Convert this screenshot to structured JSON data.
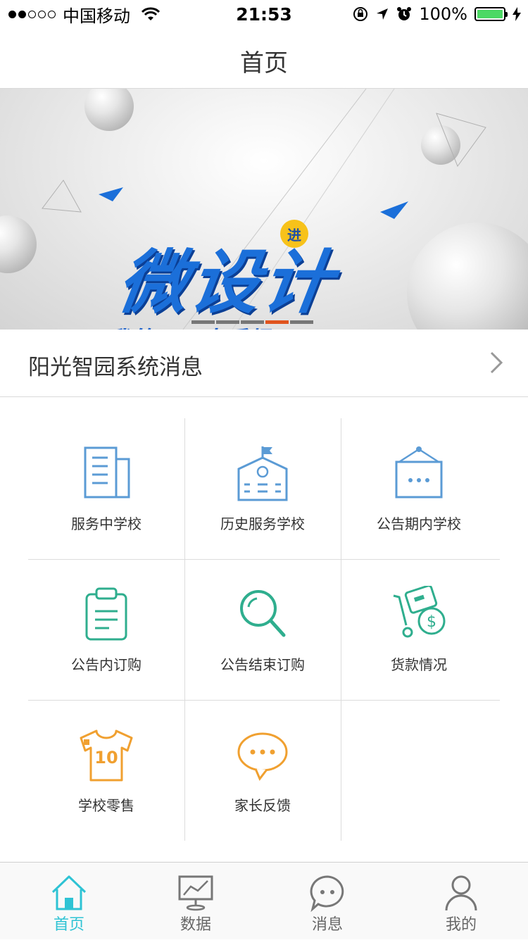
{
  "status_bar": {
    "carrier": "中国移动",
    "time": "21:53",
    "battery": "100%"
  },
  "nav": {
    "title": "首页"
  },
  "banner": {
    "tag": "进",
    "title": "微设计",
    "subtitle": "我的DIY大秀场",
    "slide_count": 5,
    "active_slide": 4
  },
  "system_message": {
    "label": "阳光智园系统消息"
  },
  "grid": {
    "items": [
      {
        "label": "服务中学校",
        "icon": "building-icon"
      },
      {
        "label": "历史服务学校",
        "icon": "school-icon"
      },
      {
        "label": "公告期内学校",
        "icon": "notice-board-icon"
      },
      {
        "label": "公告内订购",
        "icon": "clipboard-icon"
      },
      {
        "label": "公告结束订购",
        "icon": "search-icon"
      },
      {
        "label": "货款情况",
        "icon": "payment-cart-icon"
      },
      {
        "label": "学校零售",
        "icon": "shirt-icon"
      },
      {
        "label": "家长反馈",
        "icon": "chat-bubble-icon"
      }
    ]
  },
  "tab_bar": {
    "items": [
      {
        "label": "首页",
        "icon": "home-icon",
        "active": true
      },
      {
        "label": "数据",
        "icon": "chart-icon",
        "active": false
      },
      {
        "label": "消息",
        "icon": "message-icon",
        "active": false
      },
      {
        "label": "我的",
        "icon": "user-icon",
        "active": false
      }
    ]
  },
  "colors": {
    "accent_teal": "#2ec3d4",
    "blue_icon": "#5b9bd5",
    "green_icon": "#2fae8e",
    "orange_icon": "#f0a030",
    "slide_active": "#e0541e"
  }
}
